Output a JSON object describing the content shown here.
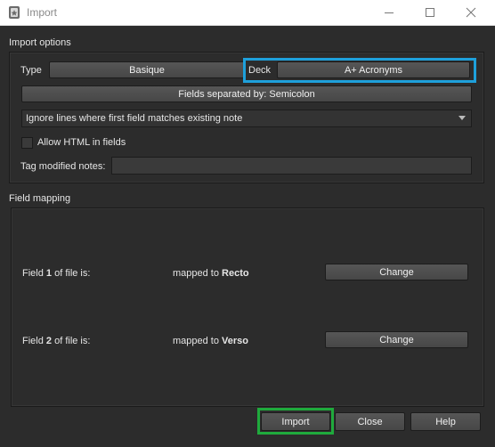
{
  "window": {
    "title": "Import"
  },
  "import_options": {
    "section_title": "Import options",
    "type_label": "Type",
    "type_value": "Basique",
    "deck_label": "Deck",
    "deck_value": "A+ Acronyms",
    "separator_button": "Fields separated by: Semicolon",
    "duplicate_mode": "Ignore lines where first field matches existing note",
    "allow_html_label": "Allow HTML in fields",
    "allow_html_checked": false,
    "tag_label": "Tag modified notes:",
    "tag_value": ""
  },
  "field_mapping": {
    "section_title": "Field mapping",
    "rows": [
      {
        "prefix": "Field ",
        "num": "1",
        "suffix": " of file is:",
        "mapped_prefix": "mapped to ",
        "target": "Recto",
        "button": "Change"
      },
      {
        "prefix": "Field ",
        "num": "2",
        "suffix": " of file is:",
        "mapped_prefix": "mapped to ",
        "target": "Verso",
        "button": "Change"
      }
    ]
  },
  "footer": {
    "import": "Import",
    "close": "Close",
    "help": "Help"
  },
  "colors": {
    "blue_highlight": "#1ea0db",
    "green_highlight": "#1faa3c"
  },
  "icons": {
    "app": "anki-app-icon",
    "minimize": "minimize-icon",
    "maximize": "maximize-icon",
    "close": "close-icon",
    "dropdown": "chevron-down-icon"
  }
}
